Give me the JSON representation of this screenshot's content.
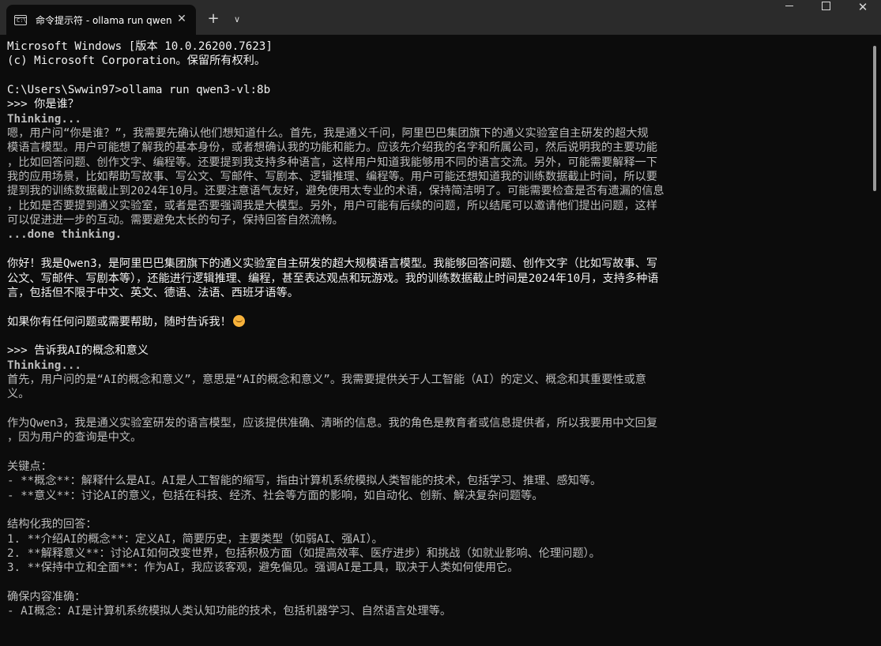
{
  "window": {
    "tab_title": "命令提示符 - ollama  run qwen",
    "tab_icon_glyph": "C:\\",
    "tab_close_glyph": "✕",
    "new_tab_glyph": "+",
    "dropdown_glyph": "∨",
    "close_glyph": "✕"
  },
  "console": {
    "lines": [
      {
        "text": "Microsoft Windows [版本 10.0.26200.7623]",
        "style": "bright"
      },
      {
        "text": "(c) Microsoft Corporation。保留所有权利。",
        "style": "bright"
      },
      {
        "text": "",
        "style": "bright"
      },
      {
        "text": "C:\\Users\\Swwin97>ollama run qwen3-vl:8b",
        "style": "bright"
      },
      {
        "text": ">>> 你是谁？",
        "style": "bright"
      },
      {
        "text": "Thinking...",
        "style": "think"
      },
      {
        "text": "嗯，用户问“你是谁？”，我需要先确认他们想知道什么。首先，我是通义千问，阿里巴巴集团旗下的通义实验室自主研发的超大规",
        "style": "dim"
      },
      {
        "text": "模语言模型。用户可能想了解我的基本身份，或者想确认我的功能和能力。应该先介绍我的名字和所属公司，然后说明我的主要功能",
        "style": "dim"
      },
      {
        "text": "，比如回答问题、创作文字、编程等。还要提到我支持多种语言，这样用户知道我能够用不同的语言交流。另外，可能需要解释一下",
        "style": "dim"
      },
      {
        "text": "我的应用场景，比如帮助写故事、写公文、写邮件、写剧本、逻辑推理、编程等。用户可能还想知道我的训练数据截止时间，所以要",
        "style": "dim"
      },
      {
        "text": "提到我的训练数据截止到2024年10月。还要注意语气友好，避免使用太专业的术语，保持简洁明了。可能需要检查是否有遗漏的信息",
        "style": "dim"
      },
      {
        "text": "，比如是否要提到通义实验室，或者是否要强调我是大模型。另外，用户可能有后续的问题，所以结尾可以邀请他们提出问题，这样",
        "style": "dim"
      },
      {
        "text": "可以促进进一步的互动。需要避免太长的句子，保持回答自然流畅。",
        "style": "dim"
      },
      {
        "text": "...done thinking.",
        "style": "think"
      },
      {
        "text": "",
        "style": "bright"
      },
      {
        "text": "你好！我是Qwen3，是阿里巴巴集团旗下的通义实验室自主研发的超大规模语言模型。我能够回答问题、创作文字（比如写故事、写",
        "style": "bright"
      },
      {
        "text": "公文、写邮件、写剧本等），还能进行逻辑推理、编程，甚至表达观点和玩游戏。我的训练数据截止时间是2024年10月，支持多种语",
        "style": "bright"
      },
      {
        "text": "言，包括但不限于中文、英文、德语、法语、西班牙语等。",
        "style": "bright"
      },
      {
        "text": "",
        "style": "bright"
      },
      {
        "text": "如果你有任何问题或需要帮助，随时告诉我！",
        "style": "bright",
        "emoji": "smiling-face-icon"
      },
      {
        "text": "",
        "style": "bright"
      },
      {
        "text": ">>> 告诉我AI的概念和意义",
        "style": "bright"
      },
      {
        "text": "Thinking...",
        "style": "think"
      },
      {
        "text": "首先，用户问的是“AI的概念和意义”，意思是“AI的概念和意义”。我需要提供关于人工智能（AI）的定义、概念和其重要性或意",
        "style": "dim"
      },
      {
        "text": "义。",
        "style": "dim"
      },
      {
        "text": "",
        "style": "dim"
      },
      {
        "text": "作为Qwen3，我是通义实验室研发的语言模型，应该提供准确、清晰的信息。我的角色是教育者或信息提供者，所以我要用中文回复",
        "style": "dim"
      },
      {
        "text": "，因为用户的查询是中文。",
        "style": "dim"
      },
      {
        "text": "",
        "style": "dim"
      },
      {
        "text": "关键点：",
        "style": "dim"
      },
      {
        "text": "- **概念**：解释什么是AI。AI是人工智能的缩写，指由计算机系统模拟人类智能的技术，包括学习、推理、感知等。",
        "style": "dim"
      },
      {
        "text": "- **意义**：讨论AI的意义，包括在科技、经济、社会等方面的影响，如自动化、创新、解决复杂问题等。",
        "style": "dim"
      },
      {
        "text": "",
        "style": "dim"
      },
      {
        "text": "结构化我的回答：",
        "style": "dim"
      },
      {
        "text": "1. **介绍AI的概念**：定义AI，简要历史，主要类型（如弱AI、强AI）。",
        "style": "dim"
      },
      {
        "text": "2. **解释意义**：讨论AI如何改变世界，包括积极方面（如提高效率、医疗进步）和挑战（如就业影响、伦理问题）。",
        "style": "dim"
      },
      {
        "text": "3. **保持中立和全面**：作为AI，我应该客观，避免偏见。强调AI是工具，取决于人类如何使用它。",
        "style": "dim"
      },
      {
        "text": "",
        "style": "dim"
      },
      {
        "text": "确保内容准确：",
        "style": "dim"
      },
      {
        "text": "- AI概念：AI是计算机系统模拟人类认知功能的技术，包括机器学习、自然语言处理等。",
        "style": "dim"
      }
    ]
  }
}
